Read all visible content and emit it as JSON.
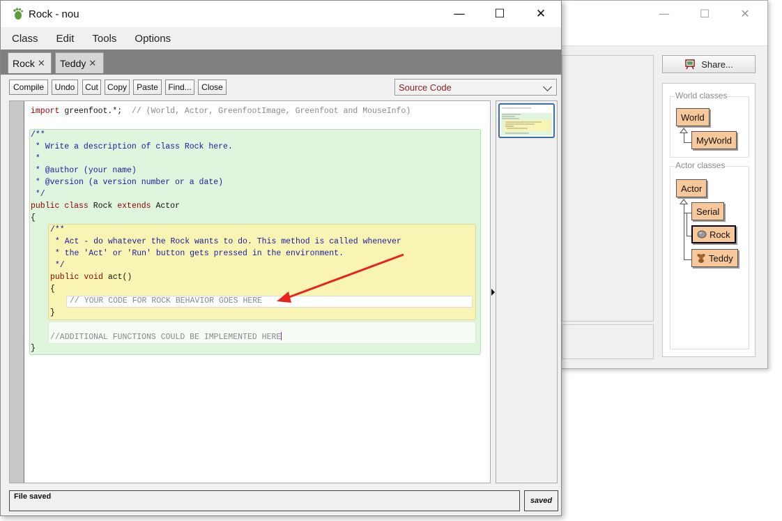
{
  "editor": {
    "title": "Rock - nou",
    "menu": [
      "Class",
      "Edit",
      "Tools",
      "Options"
    ],
    "tabs": [
      {
        "label": "Rock",
        "close": "✕"
      },
      {
        "label": "Teddy",
        "close": "✕"
      }
    ],
    "toolbar": {
      "compile": "Compile",
      "undo": "Undo",
      "cut": "Cut",
      "copy": "Copy",
      "paste": "Paste",
      "find": "Find...",
      "close": "Close"
    },
    "view_select": "Source Code",
    "code": {
      "import_kw": "import",
      "import_rest": " greenfoot.*;  ",
      "import_comment": "// (World, Actor, GreenfootImage, Greenfoot and MouseInfo)",
      "doc1": "/**",
      "doc2": " * Write a description of class Rock here.",
      "doc3": " *",
      "doc4": " * @author (your name)",
      "doc5": " * @version (a version number or a date)",
      "doc6": " */",
      "class_public": "public ",
      "class_kw": "class",
      "class_name": " Rock ",
      "class_extends": "extends",
      "class_super": " Actor",
      "brace_open": "{",
      "mdoc1": "/**",
      "mdoc2": " * Act - do whatever the Rock wants to do. This method is called whenever",
      "mdoc3": " * the 'Act' or 'Run' button gets pressed in the environment.",
      "mdoc4": " */",
      "method_public": "public ",
      "method_void": "void",
      "method_name": " act()",
      "method_open": "{",
      "body_comment": "// YOUR CODE FOR ROCK BEHAVIOR GOES HERE",
      "method_close": "}",
      "extra_comment": "//ADDITIONAL FUNCTIONS COULD BE IMPLEMENTED HERE",
      "brace_close": "}"
    },
    "status": "File saved",
    "saved_label": "saved"
  },
  "main": {
    "share_label": "Share...",
    "world_classes_label": "World classes",
    "actor_classes_label": "Actor classes",
    "world_classes": [
      "World",
      "MyWorld"
    ],
    "actor_classes": [
      "Actor",
      "Serial",
      "Rock",
      "Teddy"
    ]
  },
  "icons": {
    "app": "greenfoot-footprint-icon",
    "share": "easel-icon",
    "rock": "rock-icon",
    "teddy": "teddy-bear-icon"
  },
  "colors": {
    "class_box": "#f8c89a",
    "class_scope": "#e0f5de",
    "method_scope": "#f8f5b4",
    "annotation_arrow": "#e8231a"
  }
}
